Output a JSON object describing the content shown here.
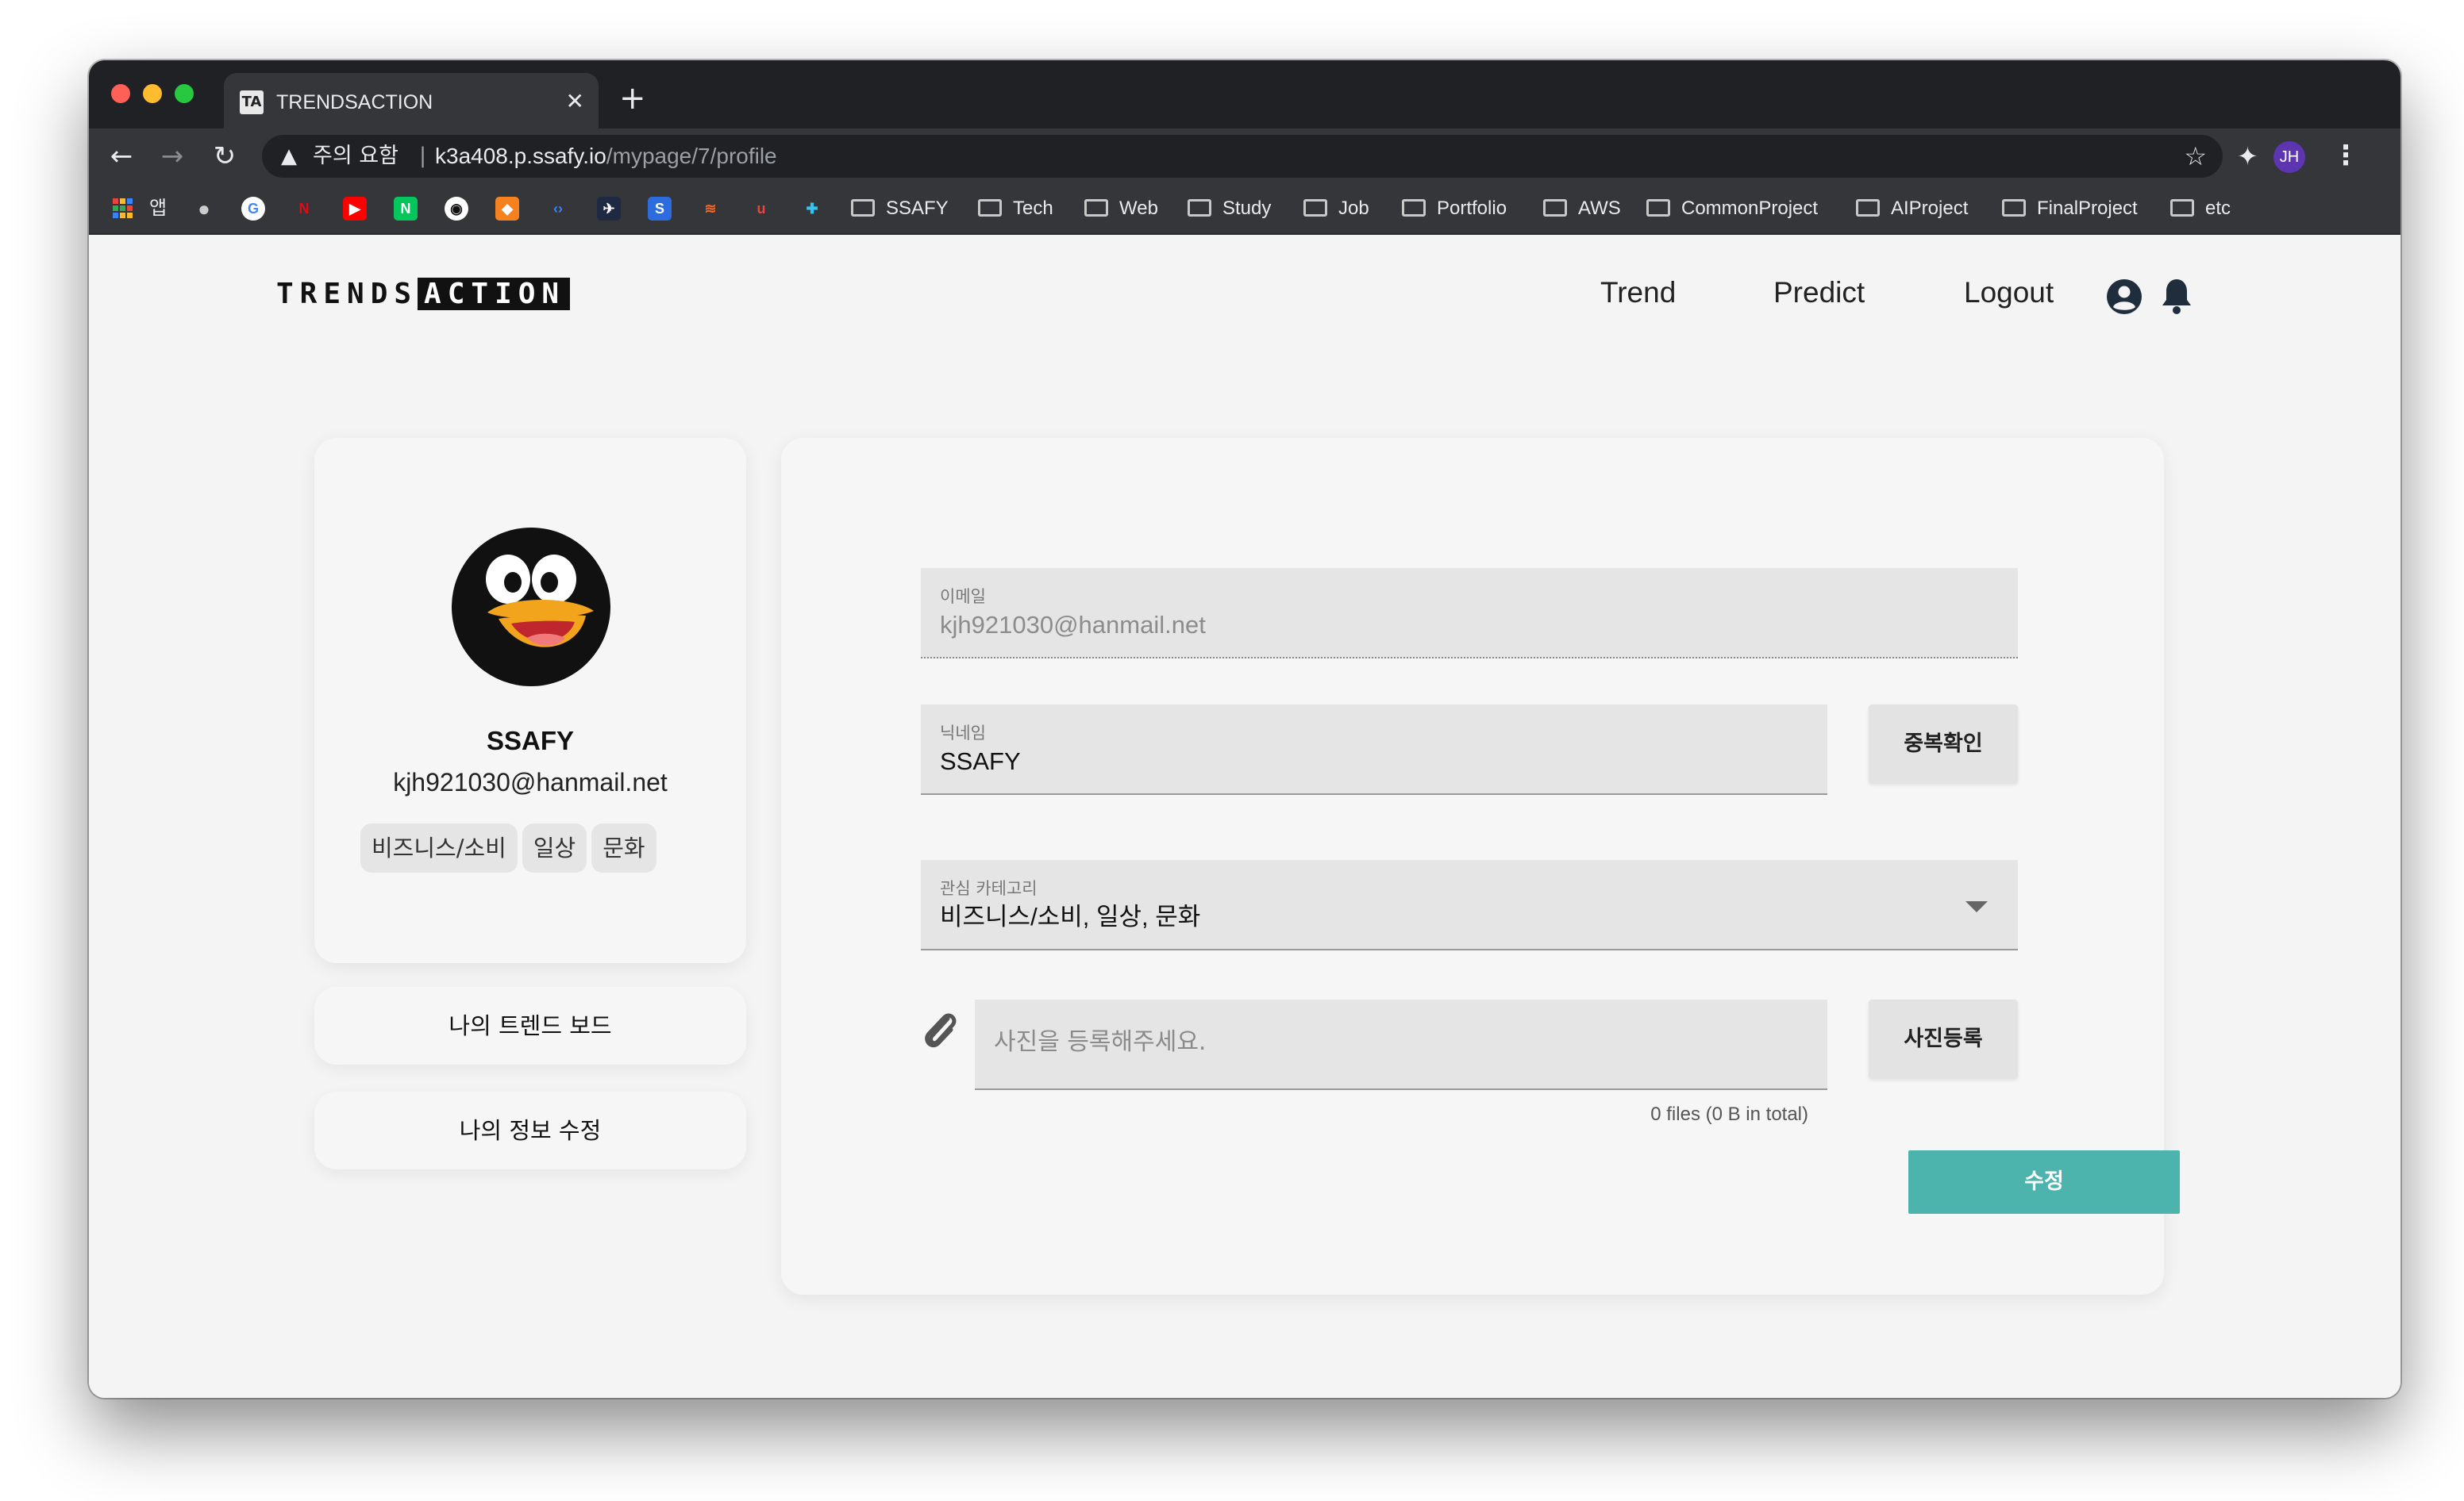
{
  "browser": {
    "tab_title": "TRENDSACTION",
    "tab_favicon": "TA",
    "security_warning": "주의 요함",
    "url_host": "k3a408.p.ssafy.io",
    "url_path": "/mypage/7/profile",
    "profile_initials": "JH",
    "bookmark_apps_label": "앱",
    "bookmark_folders": [
      "SSAFY",
      "Tech",
      "Web",
      "Study",
      "Job",
      "Portfolio",
      "AWS",
      "CommonProject",
      "AIProject",
      "FinalProject",
      "etc"
    ]
  },
  "header": {
    "logo_left": "TRENDS",
    "logo_right": "ACTION",
    "nav": [
      "Trend",
      "Predict",
      "Logout"
    ]
  },
  "profile": {
    "name": "SSAFY",
    "email": "kjh921030@hanmail.net",
    "tags": [
      "비즈니스/소비",
      "일상",
      "문화"
    ]
  },
  "side_menu": {
    "trend_board": "나의 트렌드 보드",
    "edit_info": "나의 정보 수정"
  },
  "form": {
    "email_label": "이메일",
    "email_value": "kjh921030@hanmail.net",
    "nickname_label": "닉네임",
    "nickname_value": "SSAFY",
    "dup_check_button": "중복확인",
    "category_label": "관심 카테고리",
    "category_value": "비즈니스/소비, 일상, 문화",
    "photo_placeholder": "사진을 등록해주세요.",
    "photo_button": "사진등록",
    "file_count": "0 files (0 B in total)",
    "submit_button": "수정"
  },
  "colors": {
    "accent": "#4cb3ad",
    "page_bg": "#f4f4f4",
    "field_bg": "#e5e5e5"
  }
}
